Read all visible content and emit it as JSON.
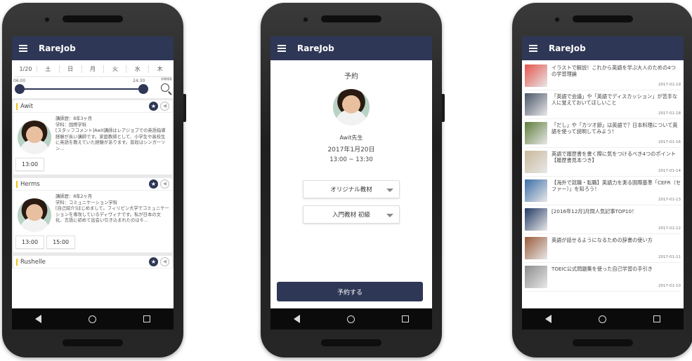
{
  "app": {
    "title": "RareJob"
  },
  "schedule": {
    "date_label": "1/20",
    "days": [
      "土",
      "日",
      "月",
      "火",
      "水",
      "木"
    ],
    "time_start": "06:00",
    "time_end": "24:30",
    "search_label": "詳細検索",
    "tutors": [
      {
        "name": "Awit",
        "career": "講師歴：8年3ヶ月",
        "major": "学科：国際学科",
        "comment": "[スタッフコメント]Awit講師はレアジョブでの英語指導経験が長い講師です。家庭教師として、小学生や高校生に英語を教えていた経験があります。普段はシンガーソン...",
        "slots": [
          "13:00"
        ]
      },
      {
        "name": "Herms",
        "career": "講師歴：8年2ヶ月",
        "major": "学科：コミュニケーション学科",
        "comment": "[自己紹介]はじめまして。フィリピン大学でコミュニケーションを専攻しているディヴィナです。私が日本の文化、言語に初めて出会い引き込まれたのは６...",
        "slots": [
          "13:00",
          "15:00"
        ]
      },
      {
        "name": "Rushelle"
      }
    ]
  },
  "booking": {
    "title": "予約",
    "teacher": "Awit先生",
    "date": "2017年1月20日",
    "time": "13:00 ~ 13:30",
    "material_select": "オリジナル教材",
    "level_select": "入門教材 初級",
    "submit_label": "予約する"
  },
  "articles": [
    {
      "title": "イラストで解説！これから英語を学ぶ大人のための4つの学習理論",
      "date": "2017-01-19",
      "color": "#e5534b"
    },
    {
      "title": "「英語で会議」や「英語でディスカッション」が苦手な人に覚えておいてほしいこと",
      "date": "2017-01-18",
      "color": "#4a5568"
    },
    {
      "title": "「だし」や「カツオ節」は英語で？日本料理について英語を使って説明してみよう！",
      "date": "2017-01-16",
      "color": "#5f7d3a"
    },
    {
      "title": "英語で履歴書を書く際に気をつけるべき4つのポイント【履歴書見本つき】",
      "date": "2017-01-14",
      "color": "#c9b89a"
    },
    {
      "title": "【海外で就職・転職】英語力を測る国際基準「CEFR（セファー）」を知ろう！",
      "date": "2017-01-13",
      "color": "#3b6ea8"
    },
    {
      "title": "[2016年12月]月間人気記事TOP10！",
      "date": "2017-01-12",
      "color": "#233a66"
    },
    {
      "title": "英語が話せるようになるための辞書の使い方",
      "date": "2017-01-11",
      "color": "#9a5b3a"
    },
    {
      "title": "TOEIC公式問題集を使った自己学習の手引き",
      "date": "2017-01-10",
      "color": "#8c8c8c"
    }
  ]
}
